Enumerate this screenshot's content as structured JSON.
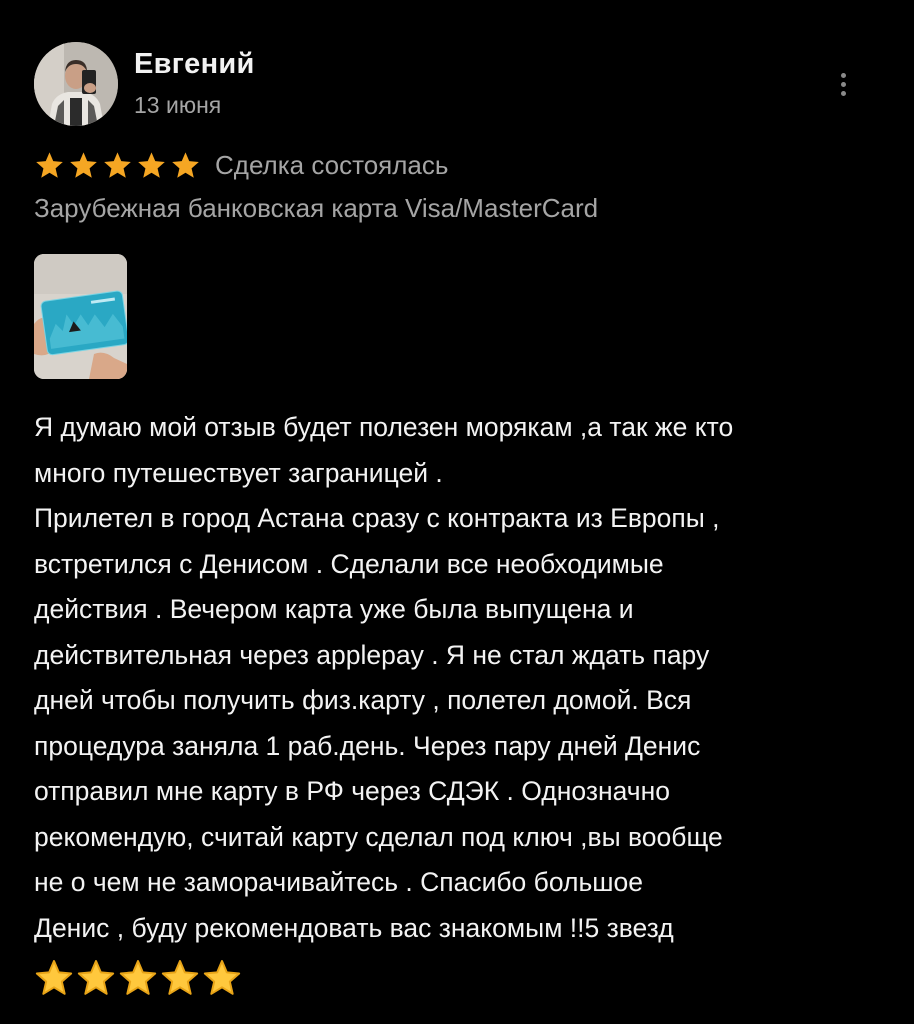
{
  "review": {
    "author_name": "Евгений",
    "date": "13 июня",
    "rating": 5,
    "rating_max": 5,
    "deal_status": "Сделка состоялась",
    "product": "Зарубежная банковская карта Visa/MasterCard",
    "text_lines": [
      "Я думаю мой отзыв будет полезен морякам ,а так же кто",
      "много путешествует заграницей .",
      "Прилетел в город Астана сразу с контракта из Европы ,",
      "встретился с Денисом . Сделали все необходимые",
      "действия . Вечером карта уже была выпущена и",
      "действительная через applepay . Я не стал ждать пару",
      "дней чтобы получить физ.карту , полетел домой. Вся",
      "процедура заняла 1 раб.день. Через пару дней Денис",
      "отправил мне карту в РФ через СДЭК . Однозначно",
      "рекомендую, считай карту сделал под ключ ,вы вообще",
      "не о чем не заморачивайтесь . Спасибо большое",
      "Денис , буду рекомендовать вас знакомым !!5 звезд"
    ],
    "emoji_star_count": 5
  },
  "colors": {
    "background": "#000000",
    "rating_star": "#f5a623",
    "emoji_star": "#ffc83d",
    "secondary_text": "#a5a5a5",
    "primary_text": "#f3f3f3"
  },
  "icons": {
    "more": "more-vertical-icon",
    "rating_star": "star-icon",
    "emoji_star": "star-emoji-icon"
  }
}
